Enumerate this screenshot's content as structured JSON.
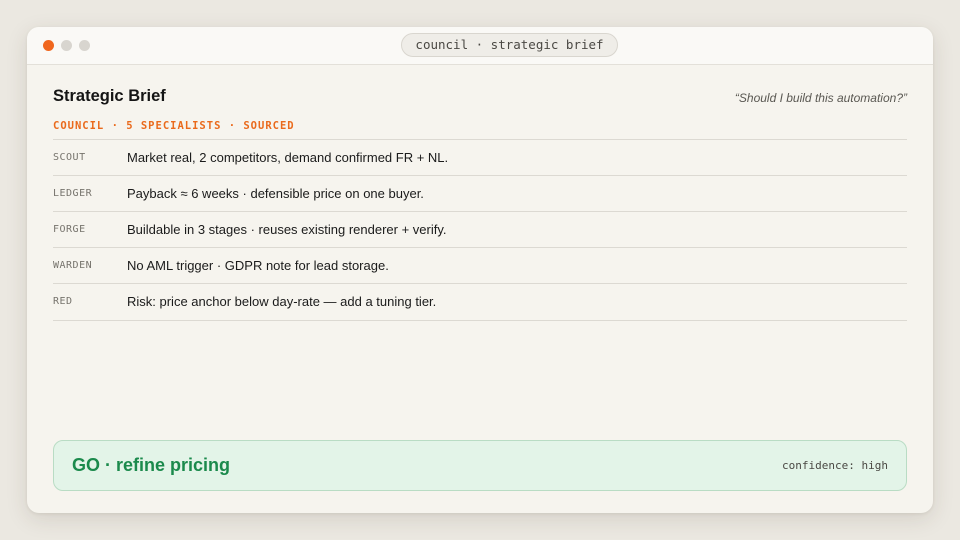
{
  "window": {
    "title": "council · strategic brief"
  },
  "brief": {
    "title": "Strategic Brief",
    "question": "“Should I build this automation?”",
    "meta": "COUNCIL · 5 SPECIALISTS · SOURCED"
  },
  "specialists": [
    {
      "role": "SCOUT",
      "text": "Market real, 2 competitors, demand confirmed FR + NL."
    },
    {
      "role": "LEDGER",
      "text": "Payback ≈ 6 weeks · defensible price on one buyer."
    },
    {
      "role": "FORGE",
      "text": "Buildable in 3 stages · reuses existing renderer + verify."
    },
    {
      "role": "WARDEN",
      "text": "No AML trigger · GDPR note for lead storage."
    },
    {
      "role": "RED",
      "text": "Risk: price anchor below day-rate — add a tuning tier."
    }
  ],
  "verdict": {
    "decision": "GO · refine pricing",
    "confidence": "confidence: high"
  },
  "colors": {
    "accent": "#ea6a1c",
    "go": "#1b8a4c",
    "go_bg": "#e3f4e8",
    "window_close": "#f0661d"
  }
}
